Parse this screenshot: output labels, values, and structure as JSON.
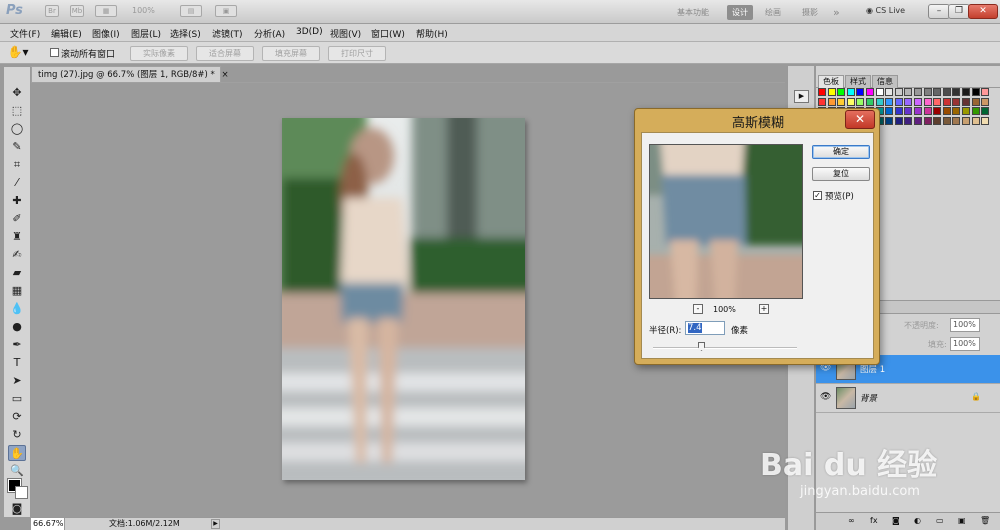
{
  "app": {
    "logo": "Ps",
    "zoom_display": "100%",
    "workspaces": [
      "基本功能",
      "设计",
      "绘画",
      "摄影"
    ],
    "active_workspace": "设计",
    "overflow": "»",
    "cs_live": "CS Live",
    "window_controls": {
      "minimize": "–",
      "restore": "❐",
      "close": "✕"
    }
  },
  "menu": [
    "文件(F)",
    "编辑(E)",
    "图像(I)",
    "图层(L)",
    "选择(S)",
    "滤镜(T)",
    "分析(A)",
    "3D(D)",
    "视图(V)",
    "窗口(W)",
    "帮助(H)"
  ],
  "options": {
    "scroll_all_label": "滚动所有窗口",
    "buttons": [
      "实际像素",
      "适合屏幕",
      "填充屏幕",
      "打印尺寸"
    ]
  },
  "document": {
    "tab_title": "timg (27).jpg @ 66.7% (图层 1, RGB/8#) *",
    "tab_close": "×"
  },
  "status": {
    "zoom": "66.67%",
    "doc_info": "文档:1.06M/2.12M"
  },
  "panels": {
    "tabs": [
      "色板",
      "样式",
      "信息"
    ],
    "active_tab": "色板",
    "opacity_label": "不透明度:",
    "opacity_value": "100%",
    "fill_label": "填充:",
    "fill_value": "100%",
    "layers": [
      {
        "name": "图层 1",
        "selected": true,
        "locked": false
      },
      {
        "name": "背景",
        "selected": false,
        "locked": true
      }
    ],
    "footer_icons": [
      "∞",
      "fx",
      "◙",
      "◐",
      "▭",
      "▣",
      "🗑"
    ]
  },
  "dialog": {
    "title": "高斯模糊",
    "ok": "确定",
    "reset": "复位",
    "preview_label": "预览(P)",
    "preview_checked": true,
    "zoom_out": "-",
    "zoom_in": "+",
    "zoom_pct": "100%",
    "radius_label": "半径(R):",
    "radius_value": "7.4",
    "radius_unit": "像素"
  },
  "watermark": {
    "brand": "Bai du 经验",
    "url": "jingyan.baidu.com"
  },
  "colors": {
    "accent_selected": "#3b92ea",
    "dialog_frame": "#d5ad5a",
    "close_red": "#c23827"
  }
}
